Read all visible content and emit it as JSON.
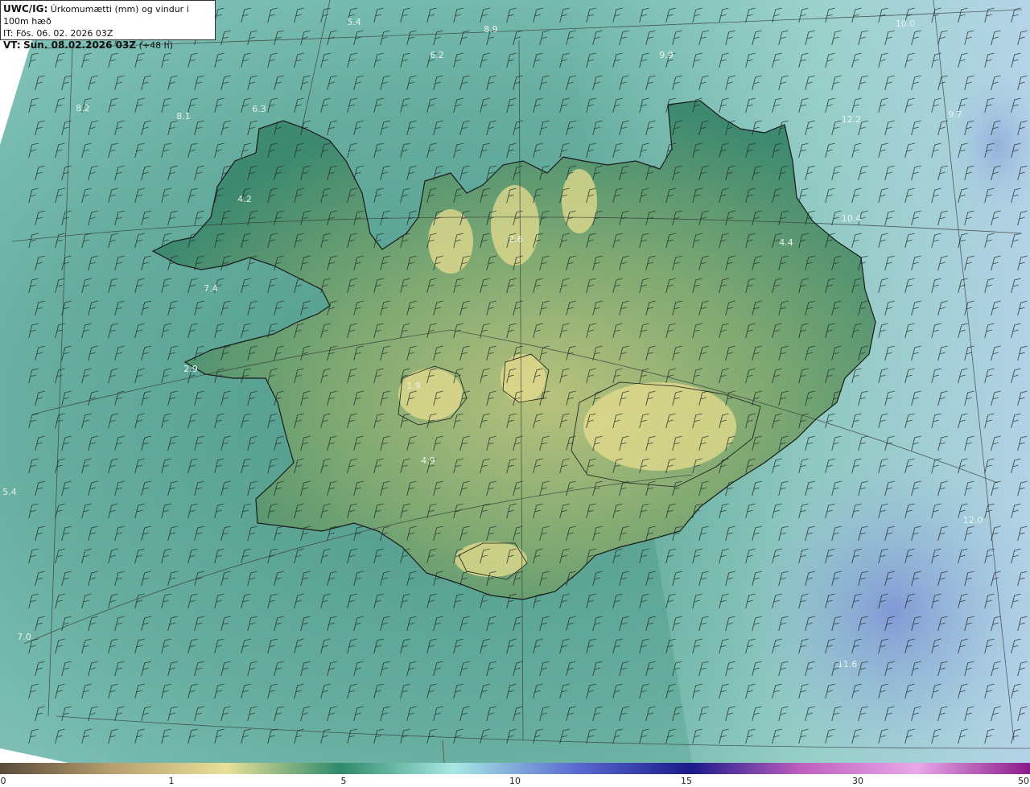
{
  "header": {
    "model_label": "UWC/IG:",
    "title": "Úrkomumætti (mm) og vindur i 100m hæð",
    "it_line": "IT: Fös. 06. 02. 2026 03Z",
    "vt_prefix": "VT:",
    "vt_line": "Sun. 08.02.2026 03Z",
    "lead": "(+48 h)"
  },
  "colors": {
    "ocean_deep": "#5fa59c",
    "ocean_light": "#9dd3cf",
    "land_low": "#3f8a72",
    "land_mid": "#7aa873",
    "land_high": "#d8d48c",
    "east_blue": "#a8c4df",
    "coast": "#1a1a1a"
  },
  "map_values": [
    {
      "text": "5.4"
    },
    {
      "text": "8.9"
    },
    {
      "text": "6.2"
    },
    {
      "text": "10.0"
    },
    {
      "text": "8.2"
    },
    {
      "text": "8.1"
    },
    {
      "text": "6.3"
    },
    {
      "text": "4.2"
    },
    {
      "text": "2.6"
    },
    {
      "text": "4.4"
    },
    {
      "text": "10.4"
    },
    {
      "text": "7.4"
    },
    {
      "text": "2.9"
    },
    {
      "text": "1.9"
    },
    {
      "text": "4.9"
    },
    {
      "text": "5.4"
    },
    {
      "text": "12.0"
    },
    {
      "text": "7.0"
    },
    {
      "text": "11.6"
    },
    {
      "text": "12.2"
    },
    {
      "text": "9.9"
    },
    {
      "text": "9.7"
    }
  ],
  "colorbar": {
    "ticks": [
      "0",
      "1",
      "5",
      "10",
      "15",
      "30",
      "50"
    ],
    "stops": [
      "#5a4a3a",
      "#b8a070",
      "#e8e098",
      "#2e8a6a",
      "#a8e8e4",
      "#5a6ad0",
      "#1a1a8a",
      "#c060c0",
      "#e8a8e8",
      "#8a1a8a"
    ]
  }
}
